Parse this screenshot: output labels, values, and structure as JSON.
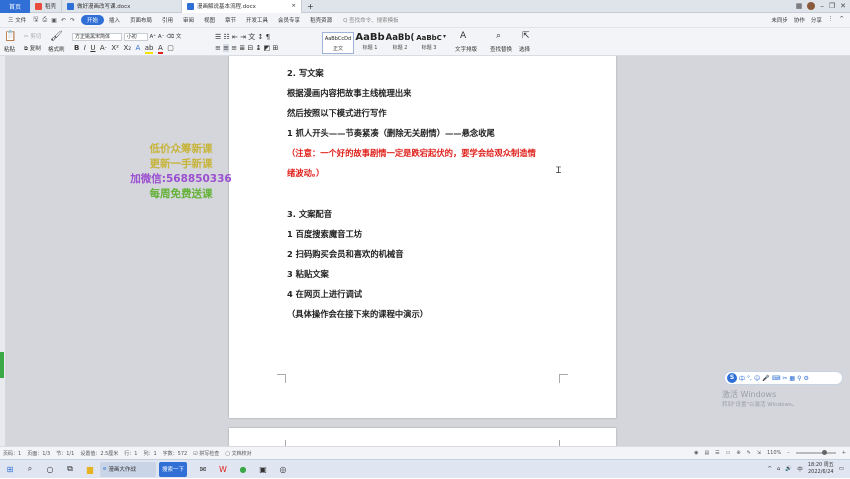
{
  "tabs": {
    "home": "首页",
    "items": [
      {
        "label": "稻壳"
      },
      {
        "label": "做好漫画改写课.docx"
      },
      {
        "label": "漫画解说基本流程.docx"
      }
    ],
    "add": "+"
  },
  "menubar": {
    "file": "三 文件",
    "items": [
      "开始",
      "插入",
      "页面布局",
      "引用",
      "审阅",
      "视图",
      "章节",
      "开发工具",
      "会员专享",
      "稻壳资源"
    ],
    "active_index": 0,
    "search": "Q 查找命令、搜索模板",
    "right": [
      "未同步",
      "协作",
      "分享"
    ]
  },
  "ribbon": {
    "paste": "粘贴",
    "cut": "剪切",
    "copy": "复制",
    "format_painter": "格式刷",
    "font_name": "方正姚黑宋简体",
    "font_size": "小初",
    "styles": [
      {
        "preview": "AaBbCcDd",
        "caption": "正文"
      },
      {
        "preview": "AaBb",
        "caption": "标题 1"
      },
      {
        "preview": "AaBb(",
        "caption": "标题 2"
      },
      {
        "preview": "AaBbC",
        "caption": "标题 3"
      }
    ],
    "text_tools": "文字排版",
    "find_replace": "查找替换",
    "select": "选择"
  },
  "document": {
    "lines": [
      {
        "text": "2. 写文案",
        "red": false
      },
      {
        "text": "根据漫画内容把故事主线梳理出来",
        "red": false
      },
      {
        "text": "然后按照以下模式进行写作",
        "red": false
      },
      {
        "text": "1 抓人开头——节奏紧凑（删除无关剧情）——悬念收尾",
        "red": false
      },
      {
        "text": "（注意：一个好的故事剧情一定是跌宕起伏的，要学会给观众制造情",
        "red": true
      },
      {
        "text": "绪波动。）",
        "red": true,
        "tail": "）"
      },
      {
        "text": "3. 文案配音",
        "red": false
      },
      {
        "text": "1 百度搜索魔音工坊",
        "red": false
      },
      {
        "text": "2 扫码购买会员和喜欢的机械音",
        "red": false
      },
      {
        "text": "3 粘贴文案",
        "red": false
      },
      {
        "text": "4 在网页上进行调试",
        "red": false
      },
      {
        "text": "（具体操作会在接下来的课程中演示）",
        "red": false
      }
    ]
  },
  "watermark": {
    "line1": "低价众筹新课",
    "line2": "更新一手新课",
    "line3": "加微信:568850336",
    "line4": "每周免费送课",
    "colors": [
      "#c7b43a",
      "#c7b43a",
      "#9b4fd1",
      "#63b136"
    ]
  },
  "ime_bar": {
    "label": "中"
  },
  "activation": {
    "title": "激活 Windows",
    "subtitle": "转到\"设置\"以激活 Windows。"
  },
  "statusbar": {
    "page": "页码：1",
    "pages": "页面：1/3",
    "section": "节：1/1",
    "position": "设置值：2.5厘米",
    "row": "行：1",
    "col": "列：1",
    "words": "字数：572",
    "spellcheck": "拼写检查",
    "proof": "文档校对",
    "zoom": "110%"
  },
  "taskbar": {
    "app1": "漫画大作战",
    "app2": "搜索一下",
    "time": "18:20 周五",
    "date": "2022/6/24"
  }
}
